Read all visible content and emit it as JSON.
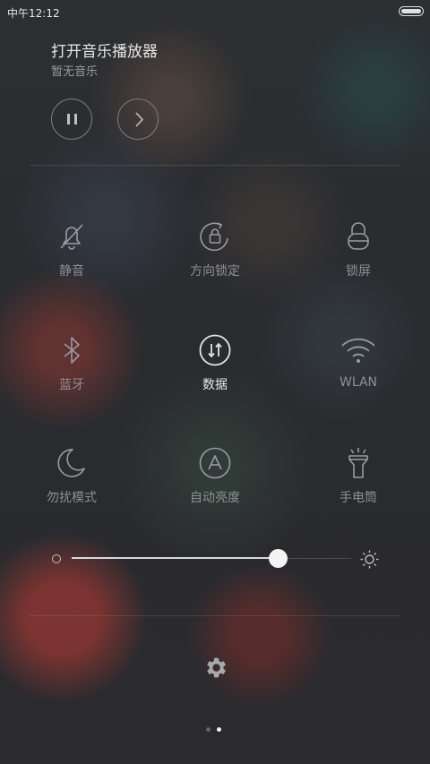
{
  "status_bar": {
    "time": "中午12:12"
  },
  "music": {
    "title": "打开音乐播放器",
    "subtitle": "暂无音乐"
  },
  "toggles": [
    {
      "label": "静音",
      "icon": "bell-off-icon",
      "active": false
    },
    {
      "label": "方向锁定",
      "icon": "rotation-lock-icon",
      "active": false
    },
    {
      "label": "锁屏",
      "icon": "lock-icon",
      "active": false
    },
    {
      "label": "蓝牙",
      "icon": "bluetooth-icon",
      "active": false
    },
    {
      "label": "数据",
      "icon": "mobile-data-icon",
      "active": true
    },
    {
      "label": "WLAN",
      "icon": "wifi-icon",
      "active": false
    },
    {
      "label": "勿扰模式",
      "icon": "moon-icon",
      "active": false
    },
    {
      "label": "自动亮度",
      "icon": "auto-brightness-icon",
      "active": false
    },
    {
      "label": "手电筒",
      "icon": "flashlight-icon",
      "active": false
    }
  ],
  "brightness": {
    "level": 0.74
  },
  "page_indicator": {
    "pages": 2,
    "current": 2
  },
  "colors": {
    "active_label": "#e8e8ea",
    "inactive_label": "#8e9094"
  }
}
